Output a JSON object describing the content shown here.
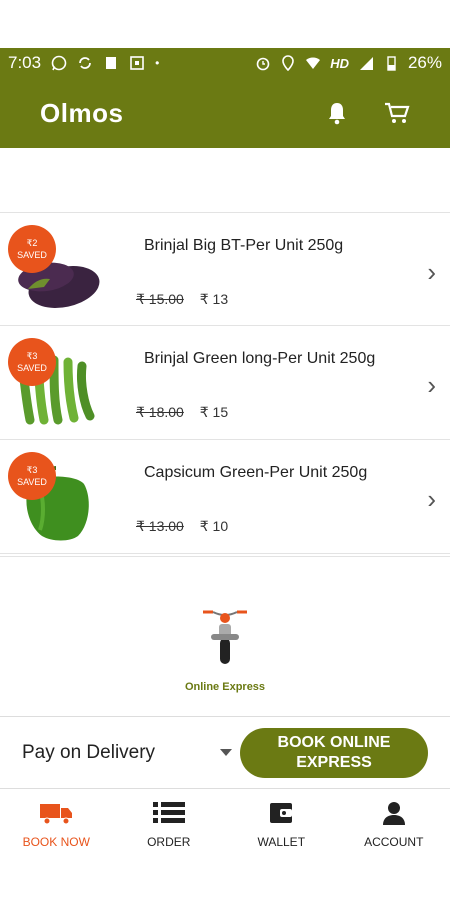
{
  "status_bar": {
    "time": "7:03",
    "network": "HD",
    "battery": "26%"
  },
  "app_bar": {
    "title": "Olmos"
  },
  "products": [
    {
      "badge_amount": "₹2",
      "badge_text": "SAVED",
      "name": "Brinjal Big BT-Per Unit 250g",
      "old_price": "₹ 15.00",
      "new_price": "₹ 13"
    },
    {
      "badge_amount": "₹3",
      "badge_text": "SAVED",
      "name": "Brinjal Green long-Per Unit 250g",
      "old_price": "₹ 18.00",
      "new_price": "₹ 15"
    },
    {
      "badge_amount": "₹3",
      "badge_text": "SAVED",
      "name": "Capsicum Green-Per Unit 250g",
      "old_price": "₹ 13.00",
      "new_price": "₹ 10"
    }
  ],
  "express": {
    "label": "Online Express"
  },
  "payment": {
    "selected": "Pay on Delivery",
    "book_button_line1": "BOOK ONLINE",
    "book_button_line2": "EXPRESS"
  },
  "bottom_nav": [
    {
      "label": "BOOK NOW",
      "icon": "truck-icon",
      "active": true
    },
    {
      "label": "ORDER",
      "icon": "list-icon",
      "active": false
    },
    {
      "label": "WALLET",
      "icon": "wallet-icon",
      "active": false
    },
    {
      "label": "ACCOUNT",
      "icon": "person-icon",
      "active": false
    }
  ],
  "colors": {
    "brand": "#6b7a13",
    "accent": "#e8541c"
  }
}
